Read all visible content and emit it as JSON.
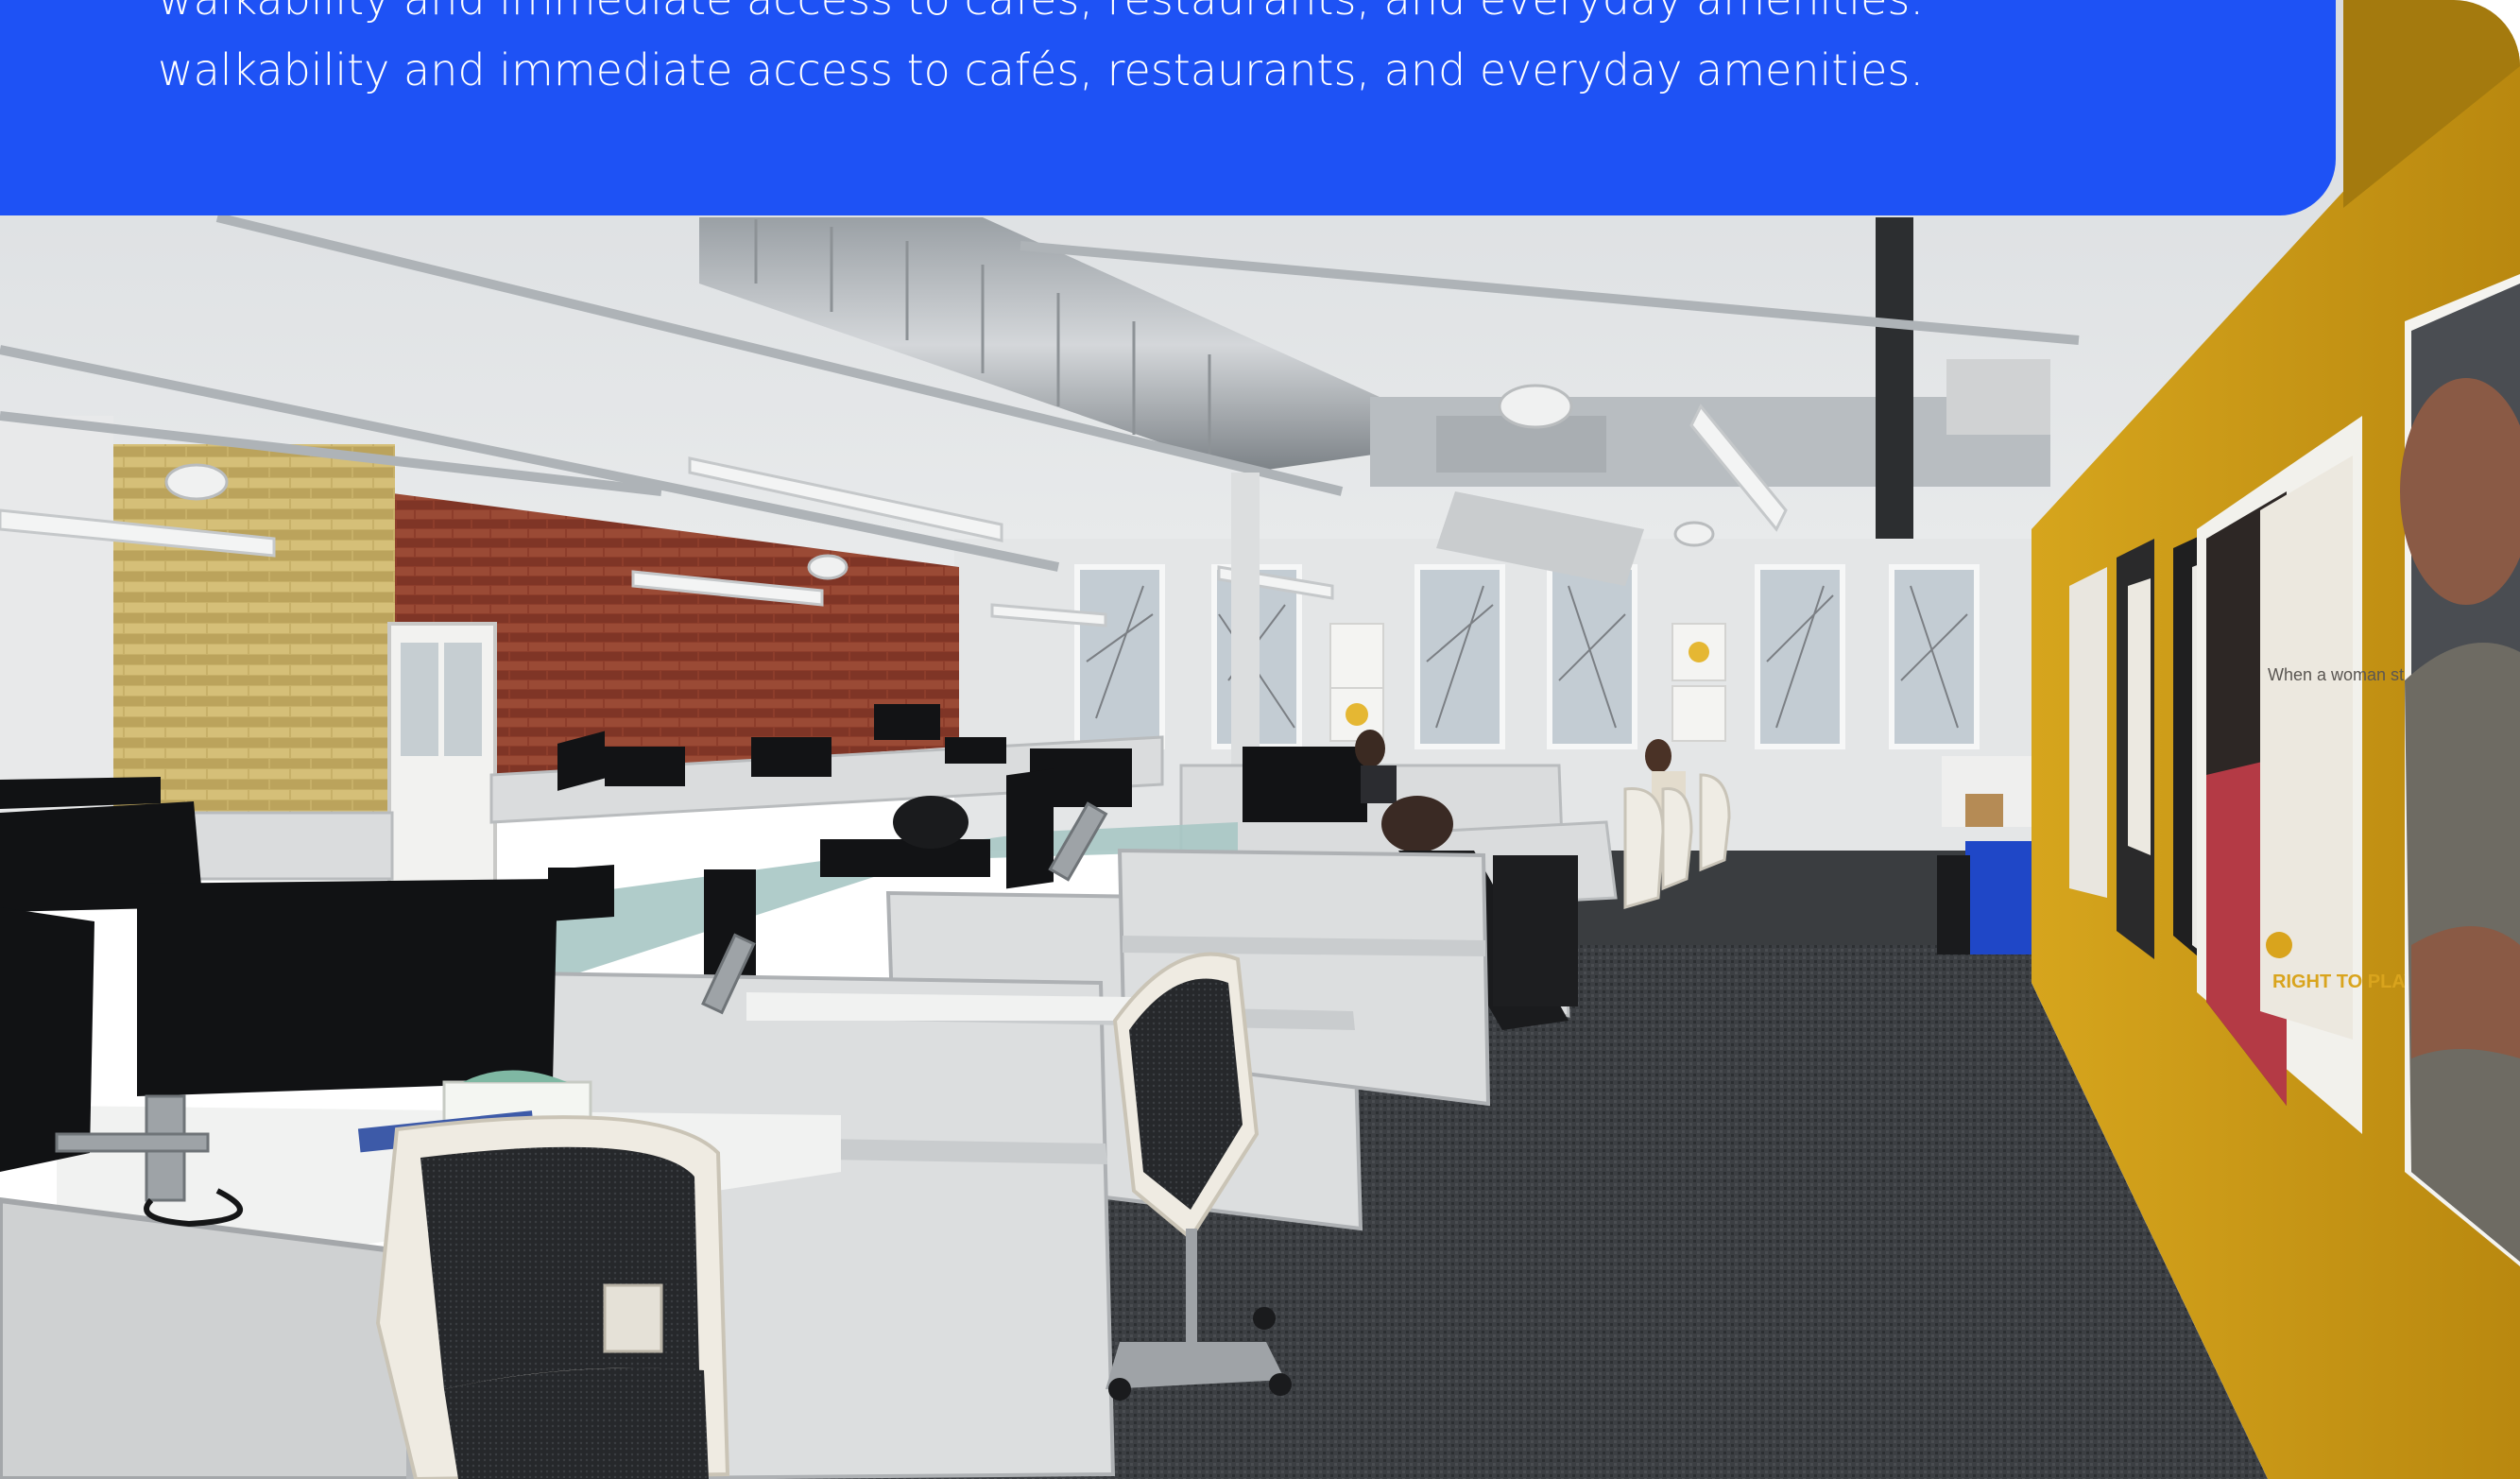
{
  "info_panel": {
    "text_line_1": "walkability and immediate access to cafés, restaurants, and everyday amenities.",
    "text_line_2": "walkability and immediate access to cafés, restaurants, and everyday amenities."
  },
  "photo": {
    "poster_1_text": "RIGHT TO PLAY",
    "poster_2_text": "RIGHT TO PLAY",
    "poster_quote_text": "When a woman studies, she can be a minister or president."
  },
  "colors": {
    "panel_blue": "#1e52f5",
    "wall_yellow": "#c99a17",
    "carpet": "#3a3d40",
    "brick": "#8a3a2a"
  }
}
